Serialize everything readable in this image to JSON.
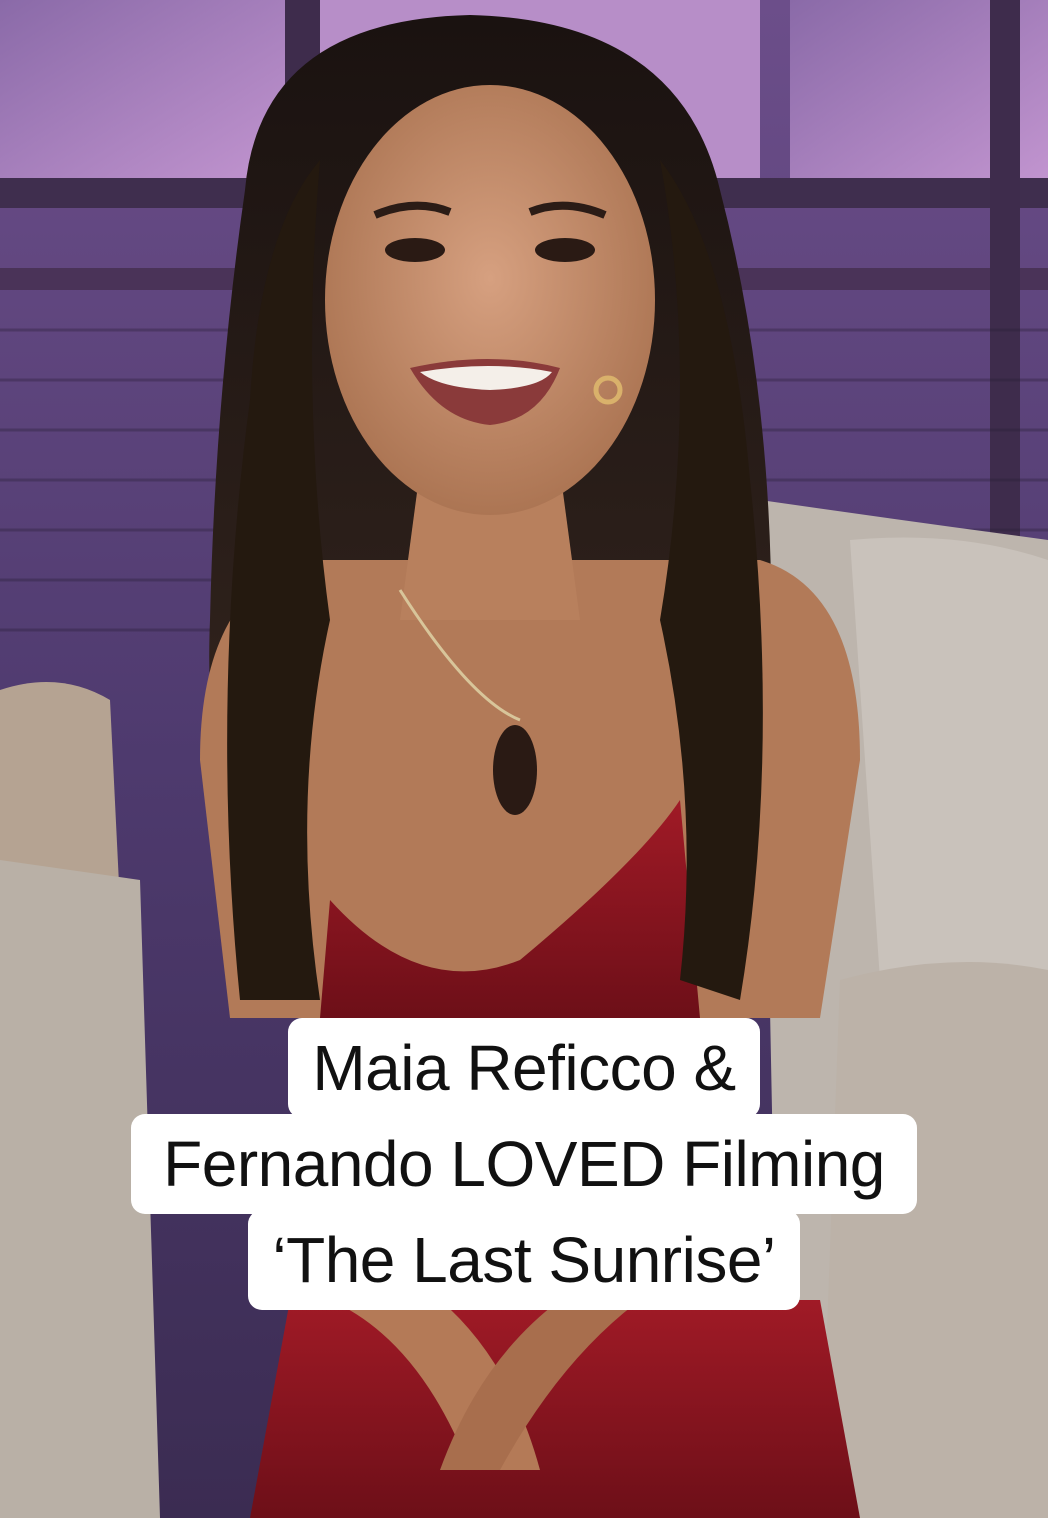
{
  "caption": {
    "line1": "Maia Reficco &",
    "line2": "Fernando LOVED Filming",
    "line3": "‘The Last Sunrise’"
  },
  "colors": {
    "backdrop_purple": "#6b4f86",
    "panel_pink": "#b38ac4",
    "dress_red": "#8e1420",
    "hair_dark": "#1e1512",
    "skin": "#c48a68",
    "sofa_grey": "#b9b0a8",
    "caption_bg": "#ffffff",
    "caption_text": "#111111"
  }
}
